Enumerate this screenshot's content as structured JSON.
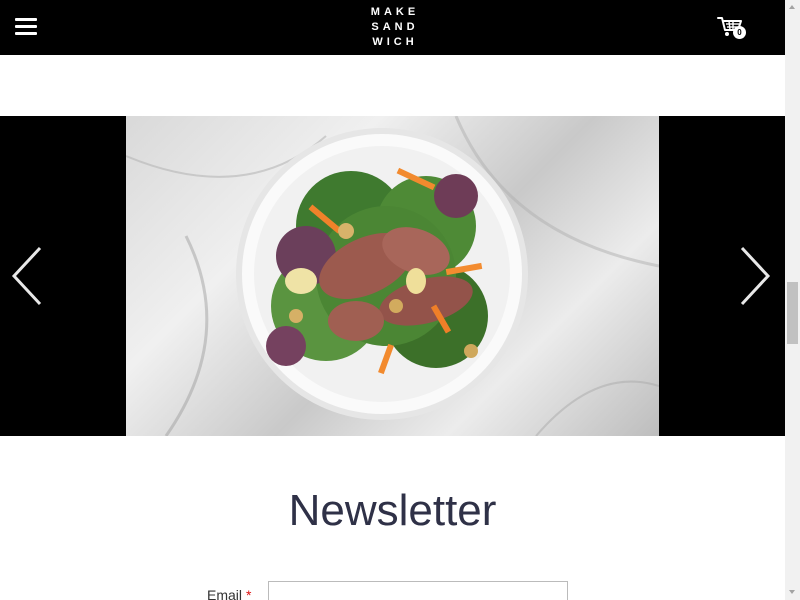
{
  "header": {
    "logo_lines": [
      "MAKE",
      "SAND",
      "WICH"
    ],
    "cart_count": "0",
    "menu_icon": "hamburger-menu-icon",
    "cart_icon": "shopping-cart-icon"
  },
  "slider": {
    "image_alt": "salad-bowl-photo",
    "prev_icon": "chevron-left-icon",
    "next_icon": "chevron-right-icon"
  },
  "newsletter": {
    "title": "Newsletter",
    "email_label": "Email",
    "required_marker": "*",
    "email_value": "",
    "email_placeholder": ""
  },
  "colors": {
    "header_bg": "#000000",
    "slider_bg": "#000000",
    "title_color": "#2f3147",
    "required_color": "#dd1111"
  }
}
